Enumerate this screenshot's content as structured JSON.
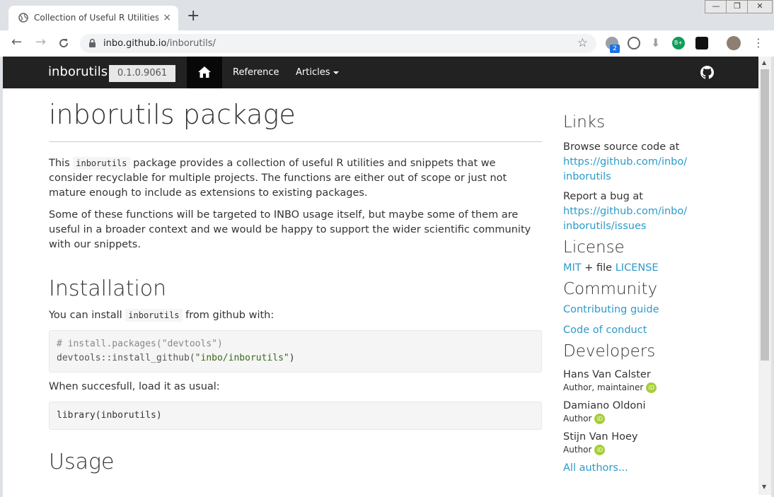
{
  "browser": {
    "tab_title": "Collection of Useful R Utilities • inborutils",
    "tab_close": "×",
    "new_tab": "+",
    "url_host": "inbo.github.io",
    "url_path": "/inborutils/",
    "window_controls": [
      "—",
      "❐",
      "✕"
    ],
    "ext_badge": "2",
    "ext_b": "B+"
  },
  "navbar": {
    "brand": "inborutils",
    "version": "0.1.0.9061",
    "links": [
      {
        "label": "Reference"
      },
      {
        "label": "Articles"
      }
    ]
  },
  "main": {
    "title": "inborutils package",
    "intro_pre": "This ",
    "intro_code": "inborutils",
    "intro_post": " package provides a collection of useful R utilities and snippets that we consider recyclable for multiple projects. The functions are either out of scope or just not mature enough to include as extensions to existing packages.",
    "para2": "Some of these functions will be targeted to INBO usage itself, but maybe some of them are useful in a broader context and we would be happy to support the wider scientific community with our snippets.",
    "install_heading": "Installation",
    "install_pre": "You can install ",
    "install_code": "inborutils",
    "install_post": " from github with:",
    "code1_comment": "# install.packages(\"devtools\")",
    "code1_fn": "devtools::install_github(",
    "code1_str": "\"inbo/inborutils\"",
    "code1_end": ")",
    "load_text": "When succesfull, load it as usual:",
    "code2": "library(inborutils)",
    "usage_heading": "Usage"
  },
  "sidebar": {
    "links_heading": "Links",
    "browse_text": "Browse source code at",
    "browse_link_1": "https://github.com/inbo/",
    "browse_link_2": "inborutils",
    "bug_text": "Report a bug at",
    "bug_link_1": "https://github.com/inbo/",
    "bug_link_2": "inborutils/issues",
    "license_heading": "License",
    "license_mit": "MIT",
    "license_mid": " + file ",
    "license_file": "LICENSE",
    "community_heading": "Community",
    "contributing": "Contributing guide",
    "conduct": "Code of conduct",
    "developers_heading": "Developers",
    "developers": [
      {
        "name": "Hans Van Calster",
        "role": "Author, maintainer"
      },
      {
        "name": "Damiano Oldoni",
        "role": "Author"
      },
      {
        "name": "Stijn Van Hoey",
        "role": "Author"
      }
    ],
    "orcid_label": "iD",
    "all_authors": "All authors..."
  }
}
